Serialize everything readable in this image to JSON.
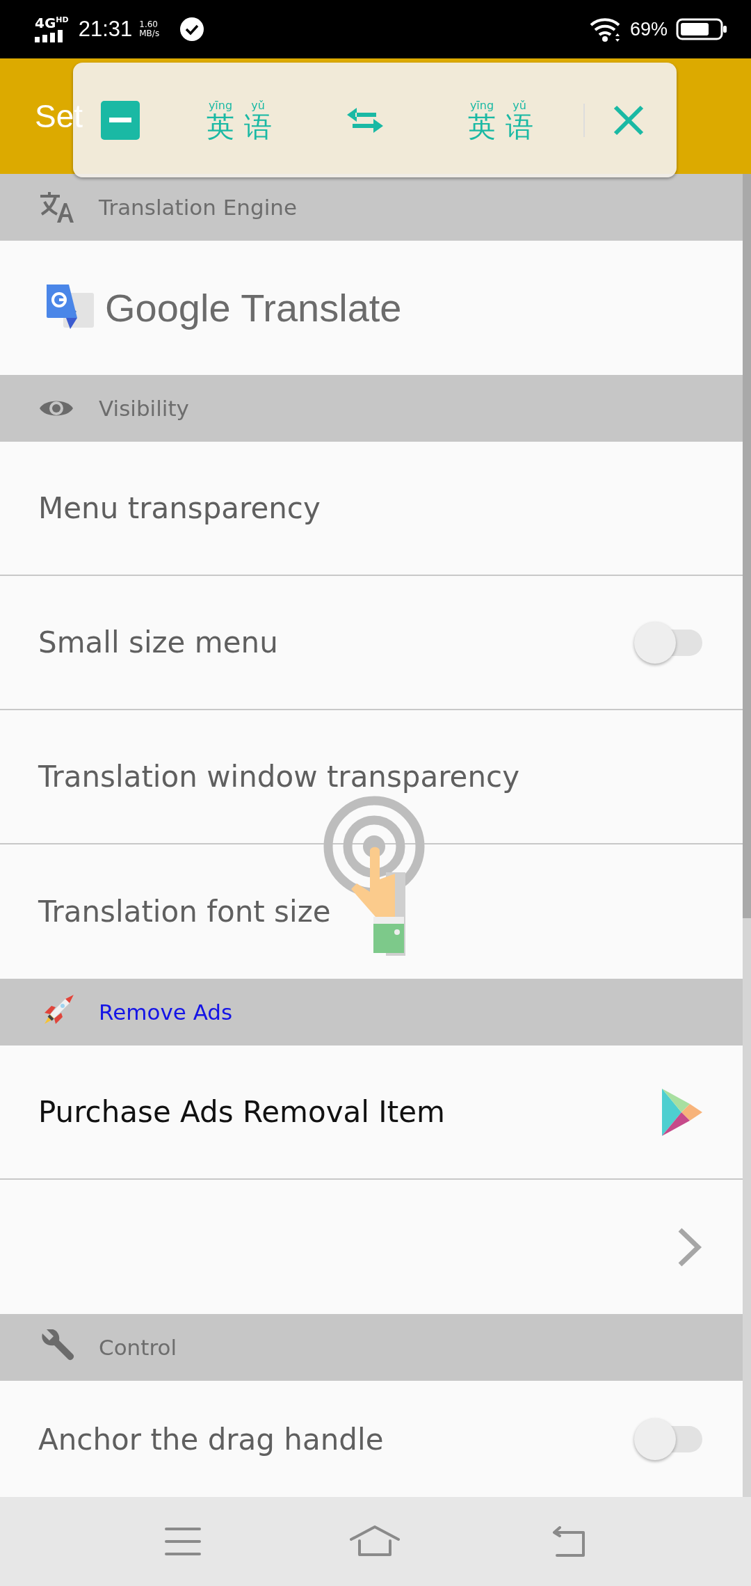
{
  "status_bar": {
    "network": "4G",
    "network_badge": "HD",
    "time": "21:31",
    "speed_value": "1.60",
    "speed_unit": "MB/s",
    "battery": "69%"
  },
  "app_bar": {
    "title": "Set"
  },
  "translate_bar": {
    "source": [
      {
        "pinyin": "yīng",
        "char": "英"
      },
      {
        "pinyin": "yǔ",
        "char": "语"
      }
    ],
    "target": [
      {
        "pinyin": "yīng",
        "char": "英"
      },
      {
        "pinyin": "yǔ",
        "char": "语"
      }
    ]
  },
  "sections": [
    {
      "title": "Translation Engine",
      "link": false,
      "items": [
        {
          "kind": "logo",
          "label": "Google Translate"
        }
      ]
    },
    {
      "title": "Visibility",
      "link": false,
      "items": [
        {
          "kind": "text",
          "label": "Menu transparency"
        },
        {
          "kind": "switch",
          "label": "Small size menu",
          "on": false
        },
        {
          "kind": "text",
          "label": "Translation window transparency"
        },
        {
          "kind": "text",
          "label": "Translation font size"
        }
      ]
    },
    {
      "title": "Remove Ads",
      "link": true,
      "items": [
        {
          "kind": "store",
          "label": "Purchase Ads Removal Item"
        },
        {
          "kind": "chevron"
        }
      ]
    },
    {
      "title": "Control",
      "link": false,
      "items": [
        {
          "kind": "switch",
          "label": "Anchor the drag handle",
          "on": false
        }
      ]
    }
  ]
}
